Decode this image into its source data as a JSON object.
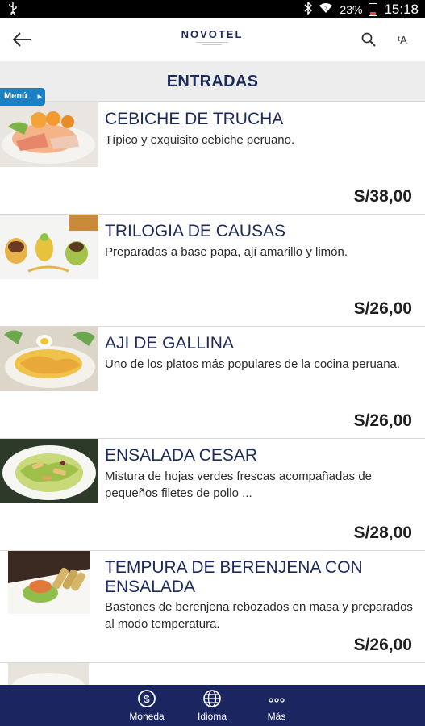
{
  "status_bar": {
    "time": "15:18",
    "battery": "23%",
    "icons": [
      "usb-icon",
      "bluetooth-icon",
      "wifi-icon",
      "battery-icon"
    ]
  },
  "app_bar": {
    "logo_text": "NOVOTEL",
    "back_icon": "arrow-left-icon",
    "search_icon": "search-icon",
    "translate_icon": "text-size-icon",
    "translate_glyph": "ᵗA"
  },
  "section": {
    "title": "ENTRADAS",
    "menu_tab": "Menú"
  },
  "items": [
    {
      "name": "CEBICHE DE TRUCHA",
      "description": "Típico y exquisito cebiche peruano.",
      "price": "S/38,00"
    },
    {
      "name": "TRILOGIA DE CAUSAS",
      "description": "Preparadas a base papa, ají amarillo y limón.",
      "price": "S/26,00"
    },
    {
      "name": "AJI DE GALLINA",
      "description": "Uno de los platos más populares de la cocina peruana.",
      "price": "S/26,00"
    },
    {
      "name": "ENSALADA CESAR",
      "description": "Mistura de hojas verdes frescas acompañadas de pequeños filetes de pollo ...",
      "price": "S/28,00"
    },
    {
      "name": "TEMPURA DE BERENJENA CON ENSALADA",
      "description": "Bastones de berenjena rebozados en masa y preparados al modo temperatura.",
      "price": "S/26,00"
    }
  ],
  "bottom_nav": [
    {
      "label": "Moneda",
      "icon": "currency-icon"
    },
    {
      "label": "Idioma",
      "icon": "globe-icon"
    },
    {
      "label": "Más",
      "icon": "more-dots-icon"
    }
  ],
  "colors": {
    "brand_navy": "#1b2660",
    "title_navy": "#1d2a5c",
    "menu_tab_blue": "#1a82c4",
    "header_gray": "#ededed"
  }
}
